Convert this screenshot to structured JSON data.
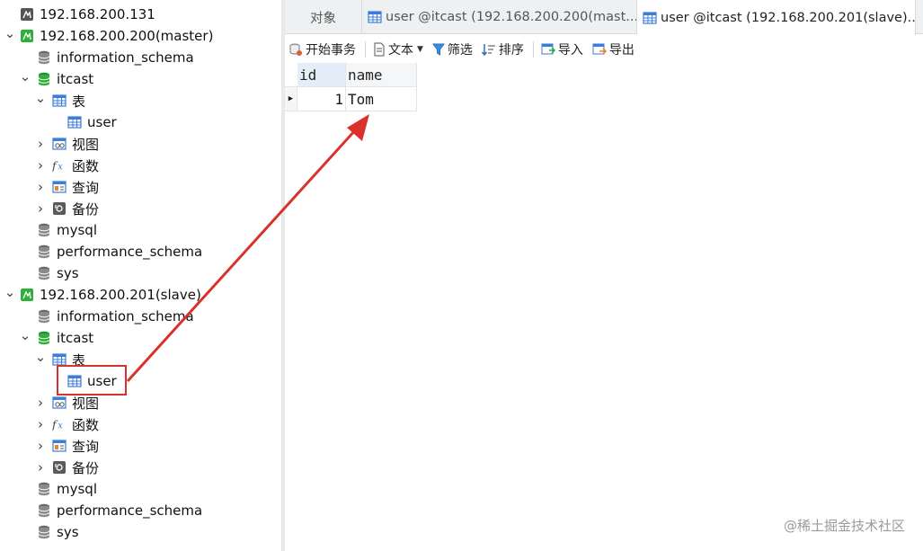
{
  "sidebar": {
    "items": [
      {
        "label": "192.168.200.131",
        "icon": "server-disconnected-icon",
        "chevron": "",
        "indent": 0
      },
      {
        "label": "192.168.200.200(master)",
        "icon": "server-connected-icon",
        "chevron": "expanded",
        "indent": 0
      },
      {
        "label": "information_schema",
        "icon": "database-gray-icon",
        "chevron": "",
        "indent": 1
      },
      {
        "label": "itcast",
        "icon": "database-green-icon",
        "chevron": "expanded",
        "indent": 1
      },
      {
        "label": "表",
        "icon": "tables-folder-icon",
        "chevron": "expanded",
        "indent": 2
      },
      {
        "label": "user",
        "icon": "table-icon",
        "chevron": "",
        "indent": 3
      },
      {
        "label": "视图",
        "icon": "view-icon",
        "chevron": "collapsed",
        "indent": 2
      },
      {
        "label": "函数",
        "icon": "function-icon",
        "chevron": "collapsed",
        "indent": 2
      },
      {
        "label": "查询",
        "icon": "query-icon",
        "chevron": "collapsed",
        "indent": 2
      },
      {
        "label": "备份",
        "icon": "backup-icon",
        "chevron": "collapsed",
        "indent": 2
      },
      {
        "label": "mysql",
        "icon": "database-gray-icon",
        "chevron": "",
        "indent": 1
      },
      {
        "label": "performance_schema",
        "icon": "database-gray-icon",
        "chevron": "",
        "indent": 1
      },
      {
        "label": "sys",
        "icon": "database-gray-icon",
        "chevron": "",
        "indent": 1
      },
      {
        "label": "192.168.200.201(slave)",
        "icon": "server-connected-icon",
        "chevron": "expanded",
        "indent": 0
      },
      {
        "label": "information_schema",
        "icon": "database-gray-icon",
        "chevron": "",
        "indent": 1
      },
      {
        "label": "itcast",
        "icon": "database-green-icon",
        "chevron": "expanded",
        "indent": 1
      },
      {
        "label": "表",
        "icon": "tables-folder-icon",
        "chevron": "expanded",
        "indent": 2
      },
      {
        "label": "user",
        "icon": "table-icon",
        "chevron": "",
        "indent": 3
      },
      {
        "label": "视图",
        "icon": "view-icon",
        "chevron": "collapsed",
        "indent": 2
      },
      {
        "label": "函数",
        "icon": "function-icon",
        "chevron": "collapsed",
        "indent": 2
      },
      {
        "label": "查询",
        "icon": "query-icon",
        "chevron": "collapsed",
        "indent": 2
      },
      {
        "label": "备份",
        "icon": "backup-icon",
        "chevron": "collapsed",
        "indent": 2
      },
      {
        "label": "mysql",
        "icon": "database-gray-icon",
        "chevron": "",
        "indent": 1
      },
      {
        "label": "performance_schema",
        "icon": "database-gray-icon",
        "chevron": "",
        "indent": 1
      },
      {
        "label": "sys",
        "icon": "database-gray-icon",
        "chevron": "",
        "indent": 1
      }
    ]
  },
  "tabs": [
    {
      "label": "对象",
      "icon": ""
    },
    {
      "label": "user @itcast (192.168.200.200(mast...",
      "icon": "table-icon"
    },
    {
      "label": "user @itcast (192.168.200.201(slave)...",
      "icon": "table-icon"
    }
  ],
  "toolbar": {
    "begin_transaction": "开始事务",
    "text": "文本",
    "filter": "筛选",
    "sort": "排序",
    "import": "导入",
    "export": "导出"
  },
  "grid": {
    "columns": [
      "id",
      "name"
    ],
    "rows": [
      [
        "1",
        "Tom"
      ]
    ]
  },
  "watermark": "@稀土掘金技术社区",
  "colors": {
    "annotation_red": "#d9312b",
    "server_green": "#2fae3a",
    "table_blue": "#3b7dd8"
  }
}
